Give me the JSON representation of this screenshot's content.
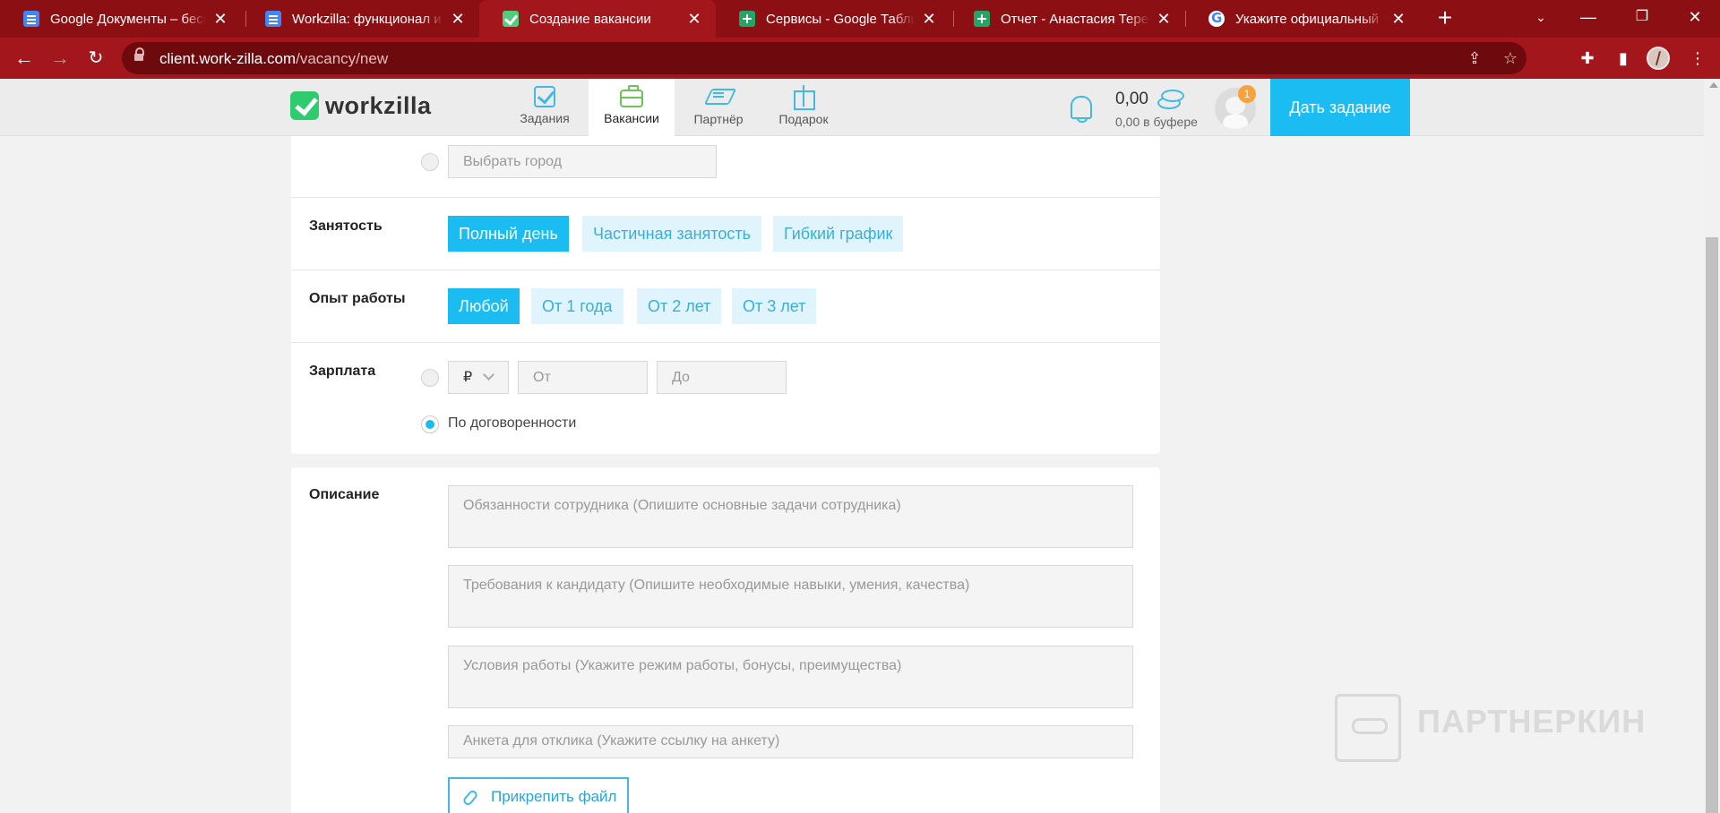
{
  "browser": {
    "tabs": [
      {
        "title": "Google Документы – бесплатно",
        "favicon": "google-docs-icon"
      },
      {
        "title": "Workzilla: функционал и возможности",
        "favicon": "google-docs-icon"
      },
      {
        "title": "Создание вакансии",
        "favicon": "workzilla-icon",
        "active": true
      },
      {
        "title": "Сервисы - Google Таблицы",
        "favicon": "google-sheets-icon"
      },
      {
        "title": "Отчет - Анастасия Терентьева",
        "favicon": "google-sheets-icon"
      },
      {
        "title": "Укажите официальный курс",
        "favicon": "google-icon"
      }
    ],
    "url_host": "client.work-zilla.com",
    "url_path": "/vacancy/new"
  },
  "header": {
    "logo_text": "workzilla",
    "nav": [
      {
        "label": "Задания",
        "icon": "tasks-icon"
      },
      {
        "label": "Вакансии",
        "icon": "briefcase-icon",
        "active": true
      },
      {
        "label": "Партнёр",
        "icon": "handshake-icon"
      },
      {
        "label": "Подарок",
        "icon": "gift-icon"
      }
    ],
    "balance": "0,00",
    "buffer": "0,00 в буфере",
    "notification_count": "1",
    "cta": "Дать задание"
  },
  "form": {
    "city_placeholder": "Выбрать город",
    "employment": {
      "label": "Занятость",
      "options": [
        "Полный день",
        "Частичная занятость",
        "Гибкий график"
      ],
      "selected": "Полный день"
    },
    "experience": {
      "label": "Опыт работы",
      "options": [
        "Любой",
        "От 1 года",
        "От 2 лет",
        "От 3 лет"
      ],
      "selected": "Любой"
    },
    "salary": {
      "label": "Зарплата",
      "currency": "₽",
      "from_placeholder": "От",
      "to_placeholder": "До",
      "negotiable_label": "По договоренности",
      "negotiable_selected": true
    },
    "description": {
      "label": "Описание",
      "duties_placeholder": "Обязанности сотрудника (Опишите основные задачи сотрудника)",
      "requirements_placeholder": "Требования к кандидату (Опишите необходимые навыки, умения, качества)",
      "conditions_placeholder": "Условия работы (Укажите режим работы, бонусы, преимущества)",
      "form_link_placeholder": "Анкета для отклика (Укажите ссылку на анкету)",
      "attach_label": "Прикрепить файл"
    }
  },
  "watermark": "ПАРТНЕРКИН",
  "colors": {
    "accent": "#1bbcf2",
    "chip_bg": "#dff4fc",
    "browser": "#a3161b",
    "logo": "#2ecb6f"
  }
}
